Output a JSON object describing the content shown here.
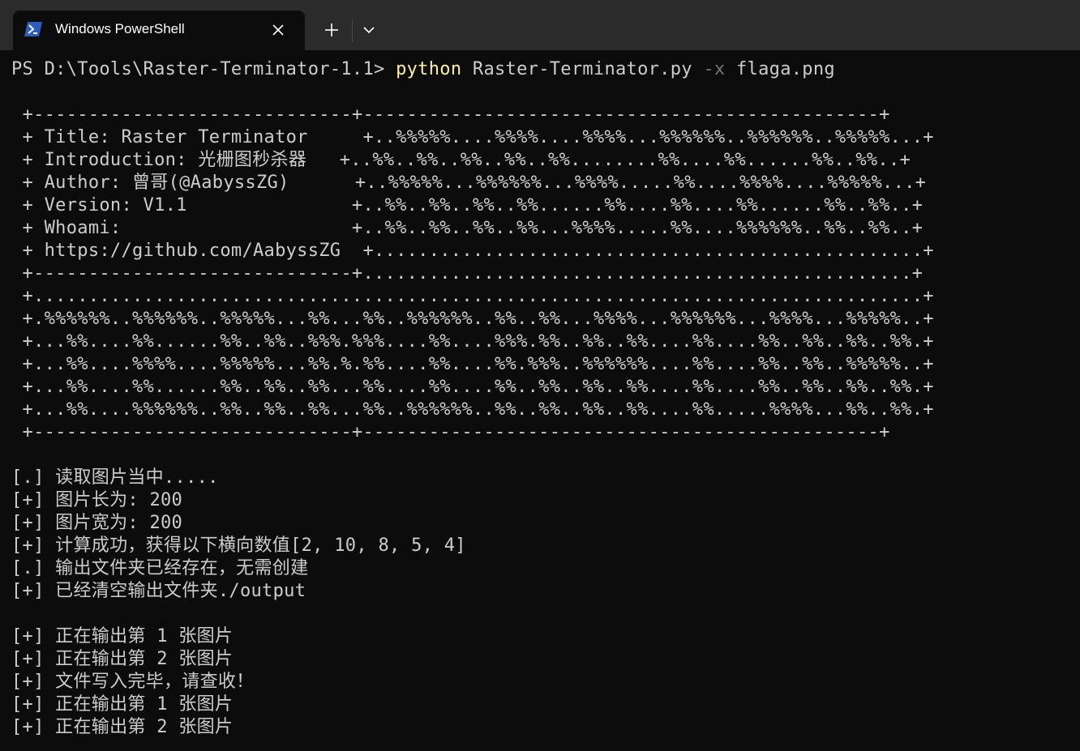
{
  "window": {
    "tab_title": "Windows PowerShell",
    "tab_icon": "powershell-icon",
    "close_icon": "close-icon",
    "new_tab_icon": "plus-icon",
    "dropdown_icon": "chevron-down-icon",
    "colors": {
      "titlebar": "#2b2b2b",
      "terminal_bg": "#0c0c0c",
      "text": "#cccccc",
      "command": "#f9f1a5",
      "flag": "#767676",
      "icon_blue": "#2d5dbb"
    }
  },
  "terminal": {
    "prompt": "PS D:\\Tools\\Raster-Terminator-1.1> ",
    "command": "python",
    "arg1": " Raster-Terminator.py ",
    "flag": "-x",
    "arg2": " flaga.png",
    "banner": [
      " +-----------------------------+-----------------------------------------------+",
      " + Title: Raster Terminator     +..%%%%%....%%%%....%%%%...%%%%%%..%%%%%%..%%%%%...+",
      " + Introduction: 光栅图秒杀器   +..%%..%%..%%..%%..%%........%%....%%......%%..%%..+",
      " + Author: 曾哥(@AabyssZG)      +..%%%%%...%%%%%%...%%%%.....%%....%%%%....%%%%%...+",
      " + Version: V1.1               +..%%..%%..%%..%%......%%....%%....%%......%%..%%..+",
      " + Whoami:                     +..%%..%%..%%..%%...%%%%.....%%....%%%%%%..%%..%%..+",
      " + https://github.com/AabyssZG  +..................................................+",
      " +-----------------------------+..................................................+",
      " +.................................................................................+",
      " +.%%%%%%..%%%%%%..%%%%%...%%...%%..%%%%%%..%%..%%...%%%%...%%%%%%...%%%%...%%%%%..+",
      " +...%%....%%......%%..%%..%%%.%%%....%%....%%%.%%..%%..%%....%%....%%..%%..%%..%%.+",
      " +...%%....%%%%....%%%%%...%%.%.%%....%%....%%.%%%..%%%%%%....%%....%%..%%..%%%%%..+",
      " +...%%....%%......%%..%%..%%...%%....%%....%%..%%..%%..%%....%%....%%..%%..%%..%%.+",
      " +...%%....%%%%%%..%%..%%..%%...%%..%%%%%%..%%..%%..%%..%%....%%.....%%%%...%%..%%.+",
      " +-----------------------------+-----------------------------------------------+"
    ],
    "output_lines": [
      "[.] 读取图片当中.....",
      "[+] 图片长为: 200",
      "[+] 图片宽为: 200",
      "[+] 计算成功，获得以下横向数值[2, 10, 8, 5, 4]",
      "[.] 输出文件夹已经存在，无需创建",
      "[+] 已经清空输出文件夹./output"
    ],
    "output_lines2": [
      "[+] 正在输出第 1 张图片",
      "[+] 正在输出第 2 张图片",
      "[+] 文件写入完毕，请查收！",
      "[+] 正在输出第 1 张图片",
      "[+] 正在输出第 2 张图片"
    ]
  }
}
